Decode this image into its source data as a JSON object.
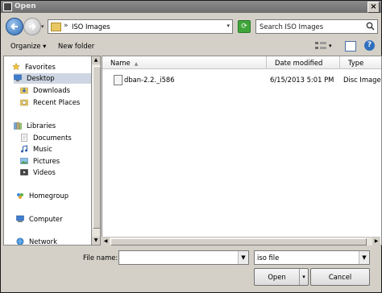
{
  "window": {
    "title": "Open"
  },
  "address": {
    "path": "ISO Images",
    "separator": "»"
  },
  "search": {
    "placeholder": "Search ISO Images"
  },
  "toolbar": {
    "organize": "Organize ▾",
    "new_folder": "New folder"
  },
  "nav": {
    "favorites": "Favorites",
    "desktop": "Desktop",
    "downloads": "Downloads",
    "recent": "Recent Places",
    "libraries": "Libraries",
    "documents": "Documents",
    "music": "Music",
    "pictures": "Pictures",
    "videos": "Videos",
    "homegroup": "Homegroup",
    "computer": "Computer",
    "network": "Network"
  },
  "columns": {
    "name": "Name",
    "date": "Date modified",
    "type": "Type"
  },
  "files": [
    {
      "name": "dban-2.2._i586",
      "date": "6/15/2013 5:01 PM",
      "type": "Disc Image F"
    }
  ],
  "footer": {
    "filename_label": "File name:",
    "filename_value": "",
    "filetype_value": "iso file",
    "open_label": "Open",
    "cancel_label": "Cancel"
  }
}
